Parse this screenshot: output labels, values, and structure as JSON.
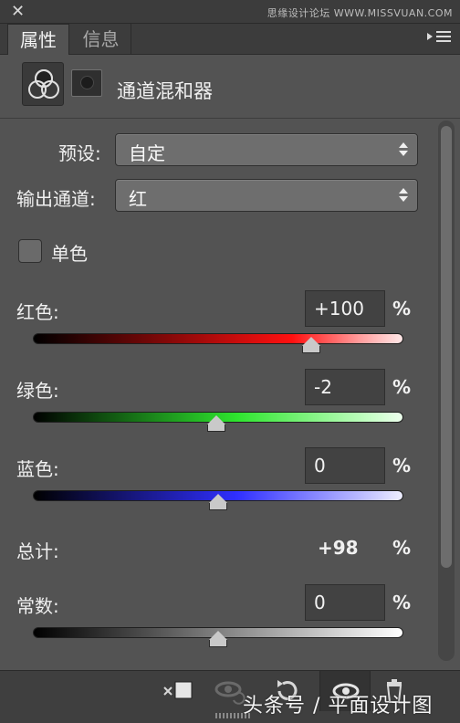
{
  "window": {
    "close_glyph": "✕",
    "watermark_top": "思缘设计论坛  WWW.MISSVUAN.COM"
  },
  "tabs": [
    {
      "label": "属性",
      "active": true
    },
    {
      "label": "信息",
      "active": false
    }
  ],
  "header": {
    "title": "通道混和器"
  },
  "preset": {
    "label": "预设:",
    "value": "自定"
  },
  "output_channel": {
    "label": "输出通道:",
    "value": "红"
  },
  "monochrome": {
    "label": "单色",
    "checked": false
  },
  "sliders": [
    {
      "label": "红色:",
      "value": "+100",
      "unit": "%",
      "fraction": 0.75,
      "color": "#ff1010"
    },
    {
      "label": "绿色:",
      "value": "-2",
      "unit": "%",
      "fraction": 0.495,
      "color": "#2ee52e"
    },
    {
      "label": "蓝色:",
      "value": "0",
      "unit": "%",
      "fraction": 0.5,
      "color": "#2f2fff"
    }
  ],
  "total": {
    "label": "总计:",
    "value": "+98",
    "unit": "%"
  },
  "constant": {
    "label": "常数:",
    "value": "0",
    "unit": "%",
    "fraction": 0.5
  },
  "bottom_toolbar": {
    "icons": [
      "clip-to-layer-icon",
      "view-previous-state-icon",
      "reset-icon",
      "toggle-visibility-icon",
      "trash-icon"
    ],
    "watermark": "头条号 / 平面设计图"
  }
}
